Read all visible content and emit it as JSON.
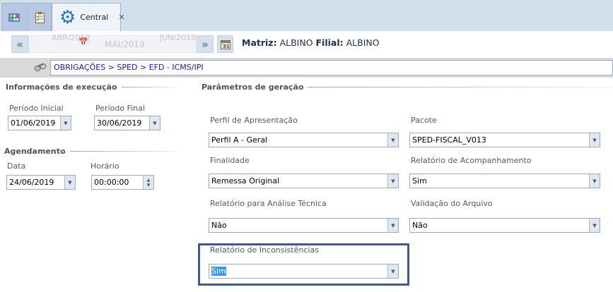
{
  "tabs": [
    {
      "icon": "grid-icon"
    },
    {
      "icon": "checklist-icon"
    },
    {
      "icon": "gear-icon",
      "label": "Central",
      "close": "✕"
    }
  ],
  "nav": {
    "prev_label": "«",
    "next_label": "»",
    "months": [
      "ABR/2019",
      "MAI/2019",
      "JUN/2019"
    ],
    "matriz_label": "Matriz:",
    "matriz_value": "ALBINO",
    "filial_label": "Filial:",
    "filial_value": "ALBINO"
  },
  "breadcrumb": "OBRIGAÇÕES > SPED > EFD - ICMS/IPI",
  "execucao": {
    "title": "Informações de execução",
    "periodo_inicial_label": "Período  Inicial",
    "periodo_inicial": "01/06/2019",
    "periodo_final_label": "Período Final",
    "periodo_final": "30/06/2019"
  },
  "agendamento": {
    "title": "Agendamento",
    "data_label": "Data",
    "data": "24/06/2019",
    "horario_label": "Horário",
    "horario": "00:00:00"
  },
  "parametros": {
    "title": "Parâmetros de geração",
    "perfil_label": "Perfil de Apresentação",
    "perfil": "Perfil A - Geral",
    "pacote_label": "Pacote",
    "pacote": "SPED-FISCAL_V013",
    "finalidade_label": "Finalidade",
    "finalidade": "Remessa Original",
    "acomp_label": "Relatório de Acompanhamento",
    "acomp": "Sim",
    "analise_label": "Relatório para Análise Técnica",
    "analise": "Não",
    "validacao_label": "Validação do Arquivo",
    "validacao": "Não",
    "inconsist_label": "Relatório de Inconsistências",
    "inconsist": "Sim"
  },
  "colors": {
    "accent": "#3f5b8a",
    "link": "#1515e8",
    "selection": "#3399ff"
  }
}
